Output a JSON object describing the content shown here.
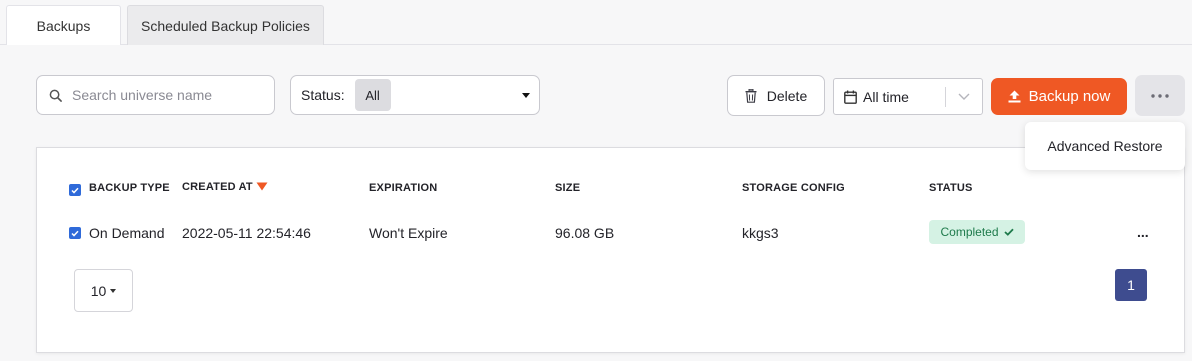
{
  "tabs": [
    {
      "label": "Backups",
      "active": true
    },
    {
      "label": "Scheduled Backup Policies",
      "active": false
    }
  ],
  "toolbar": {
    "search_placeholder": "Search universe name",
    "status_label": "Status:",
    "status_value": "All",
    "delete_label": "Delete",
    "time_range": "All time",
    "backup_now_label": "Backup now",
    "more_icon": "ellipsis-icon"
  },
  "menu": {
    "items": [
      "Advanced Restore"
    ]
  },
  "table": {
    "headers": [
      "BACKUP TYPE",
      "CREATED AT",
      "EXPIRATION",
      "SIZE",
      "STORAGE CONFIG",
      "STATUS"
    ],
    "sort_indicator": "sort-descending-icon",
    "rows": [
      {
        "backup_type": "On Demand",
        "created_at": "2022-05-11 22:54:46",
        "expiration": "Won't Expire",
        "size": "96.08 GB",
        "storage_config": "kkgs3",
        "status": "Completed",
        "actions": "..."
      }
    ]
  },
  "pagination": {
    "page_size": "10",
    "current_page": "1"
  },
  "colors": {
    "accent": "#ef5824",
    "checkbox": "#2f6ad9",
    "status_success_bg": "#d5f2e4",
    "status_success_fg": "#1e7a4b",
    "page_active": "#3e4c8f"
  }
}
